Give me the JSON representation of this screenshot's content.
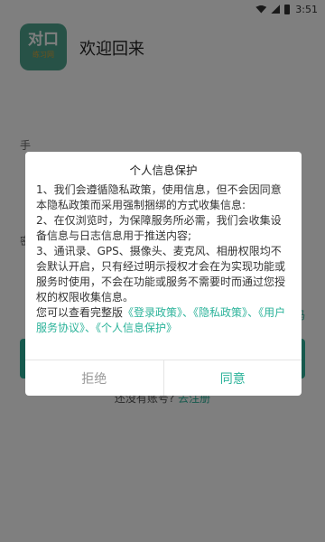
{
  "status_bar": {
    "time": "3:51"
  },
  "app": {
    "logo_main": "对口",
    "logo_sub": "练习网",
    "welcome": "欢迎回来",
    "field_hint_1": "手",
    "field_hint_2": "密",
    "side_link": "码",
    "register_prompt": "还没有账号?",
    "register_link": "去注册"
  },
  "dialog": {
    "title": "个人信息保护",
    "paragraphs": [
      "1、我们会遵循隐私政策，使用信息，但不会因同意本隐私政策而采用强制捆绑的方式收集信息:",
      "2、在仅浏览时，为保障服务所必需，我们会收集设备信息与日志信息用于推送内容;",
      "3、通讯录、GPS、摄像头、麦克风、相册权限均不会默认开启，只有经过明示授权才会在为实现功能或服务时使用，不会在功能或服务不需要时而通过您授权的权限收集信息。"
    ],
    "links_intro": "您可以查看完整版",
    "link_login_policy": "《登录政策》",
    "sep1": "、",
    "link_privacy": "《隐私政策》",
    "sep2": "、",
    "link_user_agreement": "《用户服务协议》",
    "sep3": "、",
    "link_personal_info": "《个人信息保护》",
    "reject_label": "拒绝",
    "agree_label": "同意"
  }
}
